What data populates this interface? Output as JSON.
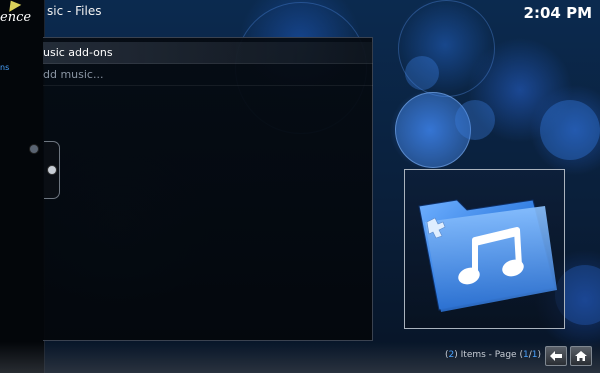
{
  "header": {
    "title": "sic - Files",
    "clock": "2:04 PM"
  },
  "sidebar": {
    "logo_text": "ence",
    "link_text": "ns"
  },
  "file_list": {
    "items": [
      {
        "label": "usic add-ons",
        "selected": true
      },
      {
        "label": "dd music...",
        "selected": false
      }
    ]
  },
  "footer": {
    "count": "2",
    "items_label": "Items - Page",
    "page_open": "(",
    "page_current": "1",
    "page_sep": "/",
    "page_total": "1",
    "page_close": ")"
  },
  "icons": {
    "thumbnail": "music-addons-folder-icon",
    "back": "back-arrow-icon",
    "home": "home-icon",
    "side_arrow": "pointer-arrow-icon"
  },
  "colors": {
    "accent": "#4aa3ff",
    "folder_blue": "#2f7be0",
    "background": "#0a1f3a"
  }
}
